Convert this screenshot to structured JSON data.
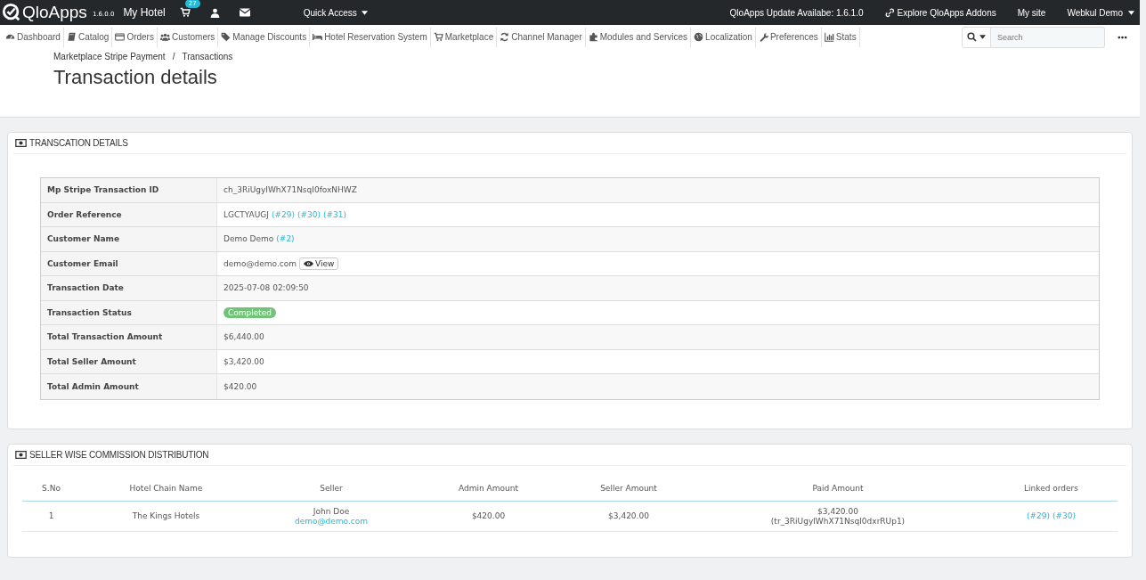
{
  "topbar": {
    "logo": "QloApps",
    "version": "1.6.0.0",
    "shop": "My Hotel",
    "cart_count": "27",
    "quick_access": "Quick Access",
    "update": "QloApps Update Availabe: 1.6.1.0",
    "addons": "Explore QloApps Addons",
    "my_site": "My site",
    "user": "Webkul Demo"
  },
  "nav": [
    {
      "label": "Dashboard"
    },
    {
      "label": "Catalog"
    },
    {
      "label": "Orders"
    },
    {
      "label": "Customers"
    },
    {
      "label": "Manage Discounts"
    },
    {
      "label": "Hotel Reservation System"
    },
    {
      "label": "Marketplace"
    },
    {
      "label": "Channel Manager"
    },
    {
      "label": "Modules and Services"
    },
    {
      "label": "Localization"
    },
    {
      "label": "Preferences"
    },
    {
      "label": "Stats"
    }
  ],
  "search": {
    "placeholder": "Search"
  },
  "breadcrumb": {
    "separator": "/",
    "items": [
      "Marketplace Stripe Payment",
      "Transactions"
    ]
  },
  "page_title": "Transaction details",
  "details": {
    "title": "TRANSCATION DETAILS",
    "rows": [
      {
        "kind": "text",
        "label": "Mp Stripe Transaction ID",
        "value": "ch_3RiUgyIWhX71NsqI0foxNHWZ"
      },
      {
        "kind": "links",
        "label": "Order Reference",
        "value": "LGCTYAUGJ",
        "links": [
          "(#29)",
          "(#30)",
          "(#31)"
        ]
      },
      {
        "kind": "links",
        "label": "Customer Name",
        "value": "Demo Demo",
        "links": [
          "(#2)"
        ]
      },
      {
        "kind": "button",
        "label": "Customer Email",
        "value": "demo@demo.com",
        "button": "View"
      },
      {
        "kind": "text",
        "label": "Transaction Date",
        "value": "2025-07-08 02:09:50"
      },
      {
        "kind": "badge",
        "label": "Transaction Status",
        "value": "Completed",
        "color": "#72c279"
      },
      {
        "kind": "text",
        "label": "Total Transaction Amount",
        "value": "$6,440.00"
      },
      {
        "kind": "text",
        "label": "Total Seller Amount",
        "value": "$3,420.00"
      },
      {
        "kind": "text",
        "label": "Total Admin Amount",
        "value": "$420.00"
      }
    ]
  },
  "commission": {
    "title": "SELLER WISE COMMISSION DISTRIBUTION",
    "columns": [
      "S.No",
      "Hotel Chain Name",
      "Seller",
      "Admin Amount",
      "Seller Amount",
      "Paid Amount",
      "Linked orders"
    ],
    "rows": [
      {
        "sno": "1",
        "hotel": "The Kings Hotels",
        "seller_name": "John Doe",
        "seller_email": "demo@demo.com",
        "admin_amount": "$420.00",
        "seller_amount": "$3,420.00",
        "paid_amount": "$3,420.00",
        "paid_reference": "(tr_3RiUgyIWhX71NsqI0dxrRUp1)",
        "linked_orders": [
          "(#29)",
          "(#30)"
        ]
      }
    ]
  }
}
